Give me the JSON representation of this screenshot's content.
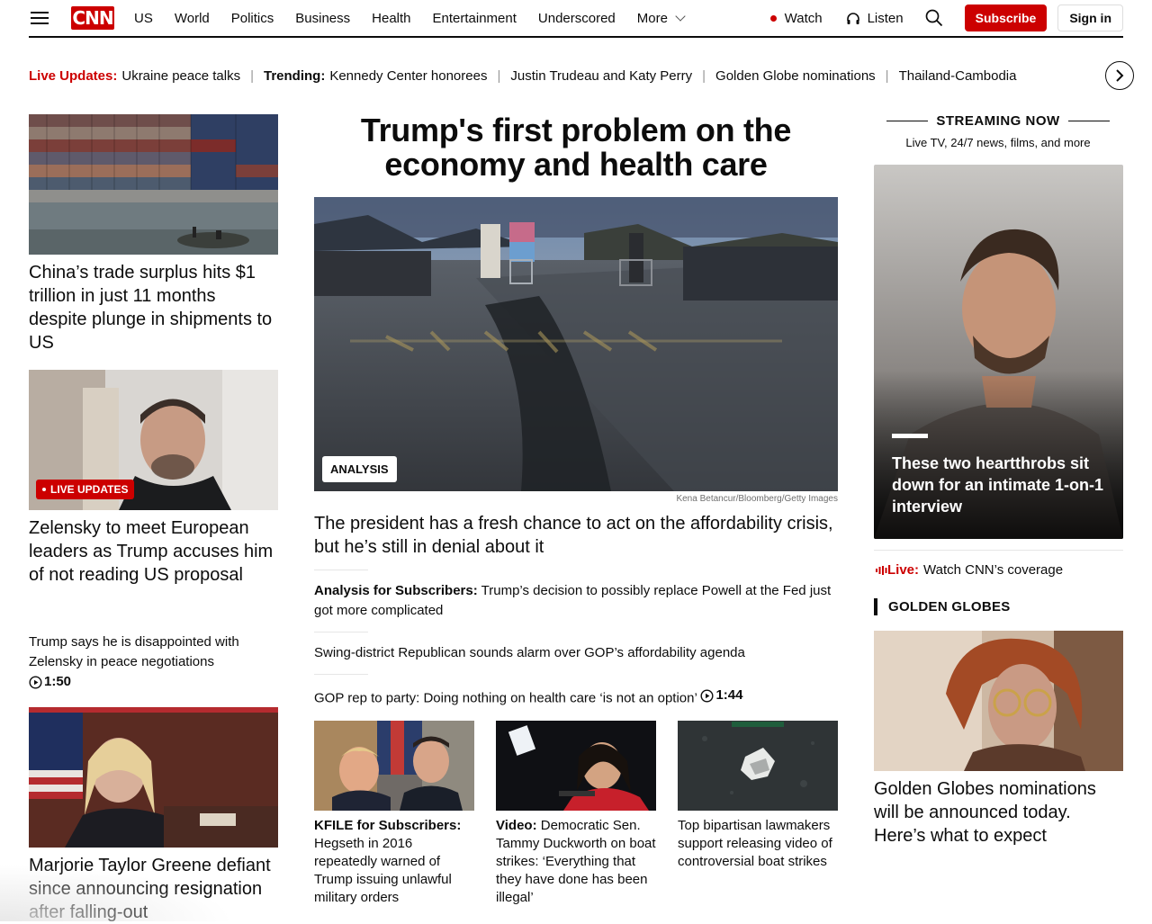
{
  "header": {
    "logo": "CNN",
    "nav": [
      "US",
      "World",
      "Politics",
      "Business",
      "Health",
      "Entertainment",
      "Underscored",
      "More"
    ],
    "watch": "Watch",
    "listen": "Listen",
    "subscribe": "Subscribe",
    "sign_in": "Sign in"
  },
  "ticker": {
    "live_label": "Live Updates:",
    "live_text": "Ukraine peace talks",
    "trending_label": "Trending:",
    "items": [
      "Kennedy Center honorees",
      "Justin Trudeau and Katy Perry",
      "Golden Globe nominations",
      "Thailand-Cambodia"
    ]
  },
  "left": {
    "story1": "China’s trade surplus hits $1 trillion in just 11 months despite plunge in shipments to US",
    "badge": "LIVE UPDATES",
    "story2": "Zelensky to meet European leaders as Trump accuses him of not reading US proposal",
    "story3_text": "Trump says he is disappointed with Zelensky in peace negotiations",
    "story3_duration": "1:50",
    "story4": "Marjorie Taylor Greene defiant since announcing resignation after falling-out"
  },
  "center": {
    "title": "Trump's first problem on the economy and health care",
    "badge": "ANALYSIS",
    "credit": "Kena Betancur/Bloomberg/Getty Images",
    "subhead": "The president has a fresh chance to act on the affordability crisis, but he’s still in denial about it",
    "item1_label": "Analysis for Subscribers:",
    "item1_text": "Trump’s decision to possibly replace Powell at the Fed just got more complicated",
    "item2_text": "Swing-district Republican sounds alarm over GOP’s affordability agenda",
    "item3_text": "GOP rep to party: Doing nothing on health care ‘is not an option’",
    "item3_duration": "1:44",
    "card1_label": "KFILE for Subscribers:",
    "card1_text": "Hegseth in 2016 repeatedly warned of Trump issuing unlawful military orders",
    "card2_label": "Video:",
    "card2_text": "Democratic Sen. Tammy Duckworth on boat strikes: ‘Everything that they have done has been illegal’",
    "card3_text": "Top bipartisan lawmakers support releasing video of controversial boat strikes"
  },
  "right": {
    "stream_title": "STREAMING NOW",
    "stream_sub": "Live TV, 24/7 news, films, and more",
    "stream_caption": "These two heartthrobs sit down for an intimate 1-on-1 interview",
    "live_label": "Live:",
    "live_text": "Watch CNN’s coverage",
    "section": "GOLDEN GLOBES",
    "story": "Golden Globes nominations will be announced today. Here’s what to expect"
  }
}
